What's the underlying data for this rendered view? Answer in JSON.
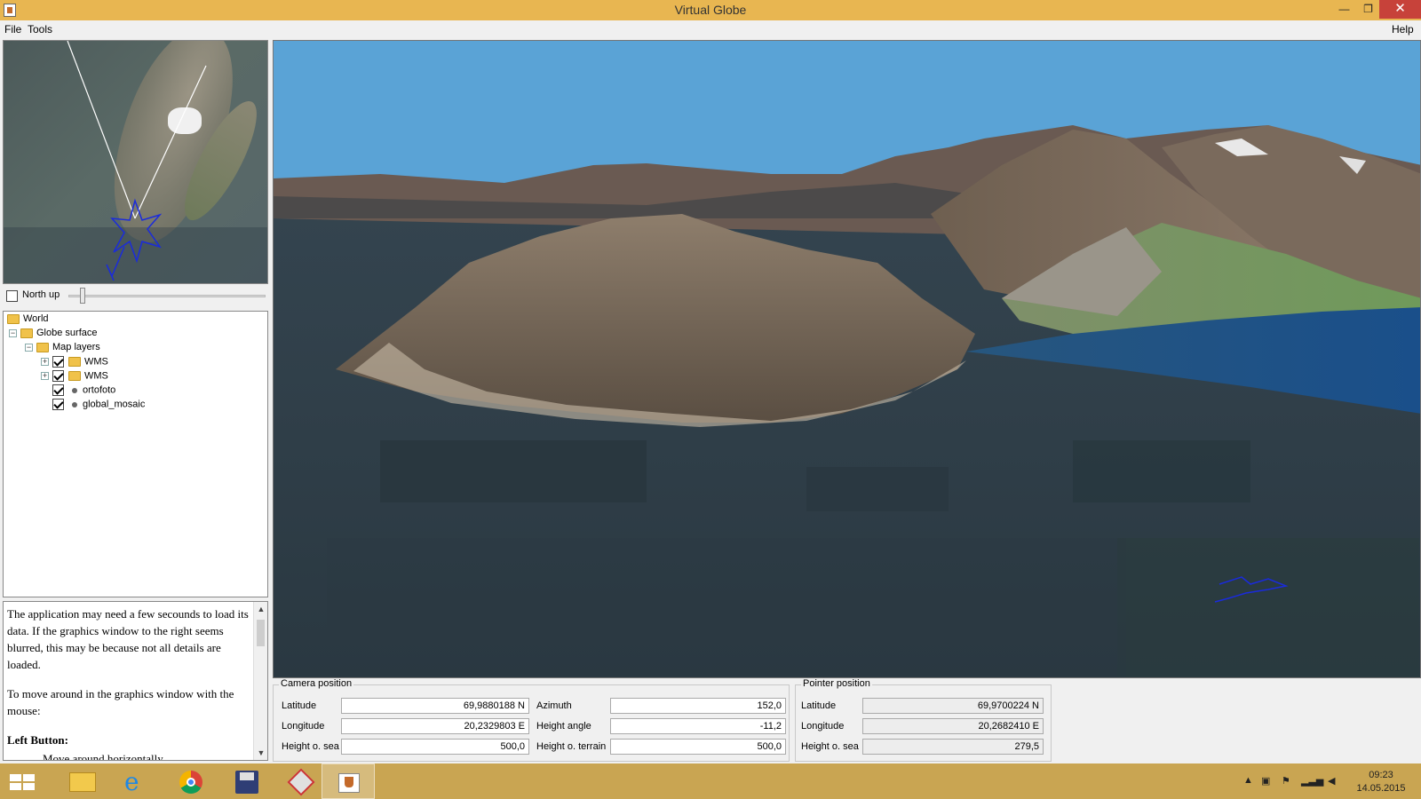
{
  "window": {
    "title": "Virtual Globe",
    "minimize": "—",
    "maximize": "❐",
    "close": "✕"
  },
  "menu": {
    "file": "File",
    "tools": "Tools",
    "help": "Help"
  },
  "northup": {
    "label": "North up",
    "checked": false
  },
  "tree": [
    {
      "label": "World",
      "level": 0,
      "expander": "",
      "icon": "folder-icon",
      "checked": null
    },
    {
      "label": "Globe surface",
      "level": 1,
      "expander": "−",
      "icon": "folder-icon",
      "checked": null
    },
    {
      "label": "Map layers",
      "level": 2,
      "expander": "−",
      "icon": "folder-icon",
      "checked": null
    },
    {
      "label": "WMS",
      "level": 3,
      "expander": "+",
      "icon": "folder-icon",
      "checked": true
    },
    {
      "label": "WMS",
      "level": 3,
      "expander": "+",
      "icon": "folder-icon",
      "checked": true
    },
    {
      "label": "ortofoto",
      "level": 3,
      "expander": "",
      "icon": "layer-dot-icon",
      "checked": true
    },
    {
      "label": "global_mosaic",
      "level": 3,
      "expander": "",
      "icon": "layer-dot-icon",
      "checked": true
    }
  ],
  "help": {
    "p1": "The application may need a few secounds to load its data. If the graphics window to the right seems blurred, this may be because not all details are loaded.",
    "p2": "To move around in the graphics window with the mouse:",
    "heading": "Left Button:",
    "item": "Move around horizontally"
  },
  "camera": {
    "title": "Camera position",
    "latitude_label": "Latitude",
    "latitude": "69,9880188 N",
    "longitude_label": "Longitude",
    "longitude": "20,2329803 E",
    "height_sea_label": "Height o. sea",
    "height_sea": "500,0",
    "azimuth_label": "Azimuth",
    "azimuth": "152,0",
    "height_angle_label": "Height angle",
    "height_angle": "-11,2",
    "height_terrain_label": "Height o. terrain",
    "height_terrain": "500,0"
  },
  "pointer": {
    "title": "Pointer position",
    "latitude_label": "Latitude",
    "latitude": "69,9700224 N",
    "longitude_label": "Longitude",
    "longitude": "20,2682410 E",
    "height_sea_label": "Height o. sea",
    "height_sea": "279,5"
  },
  "taskbar": {
    "items": [
      "start-icon",
      "file-explorer-icon",
      "internet-explorer-icon",
      "chrome-icon",
      "save-disk-icon",
      "puzzle-app-icon",
      "java-app-icon"
    ],
    "time": "09:23",
    "date": "14.05.2015"
  },
  "colors": {
    "titlebar": "#e8b651",
    "close": "#c7423a",
    "taskbar": "#c9a552",
    "sky": "#5aa3d6",
    "water": "#1e5b8e",
    "marker": "#1a2bdc"
  }
}
